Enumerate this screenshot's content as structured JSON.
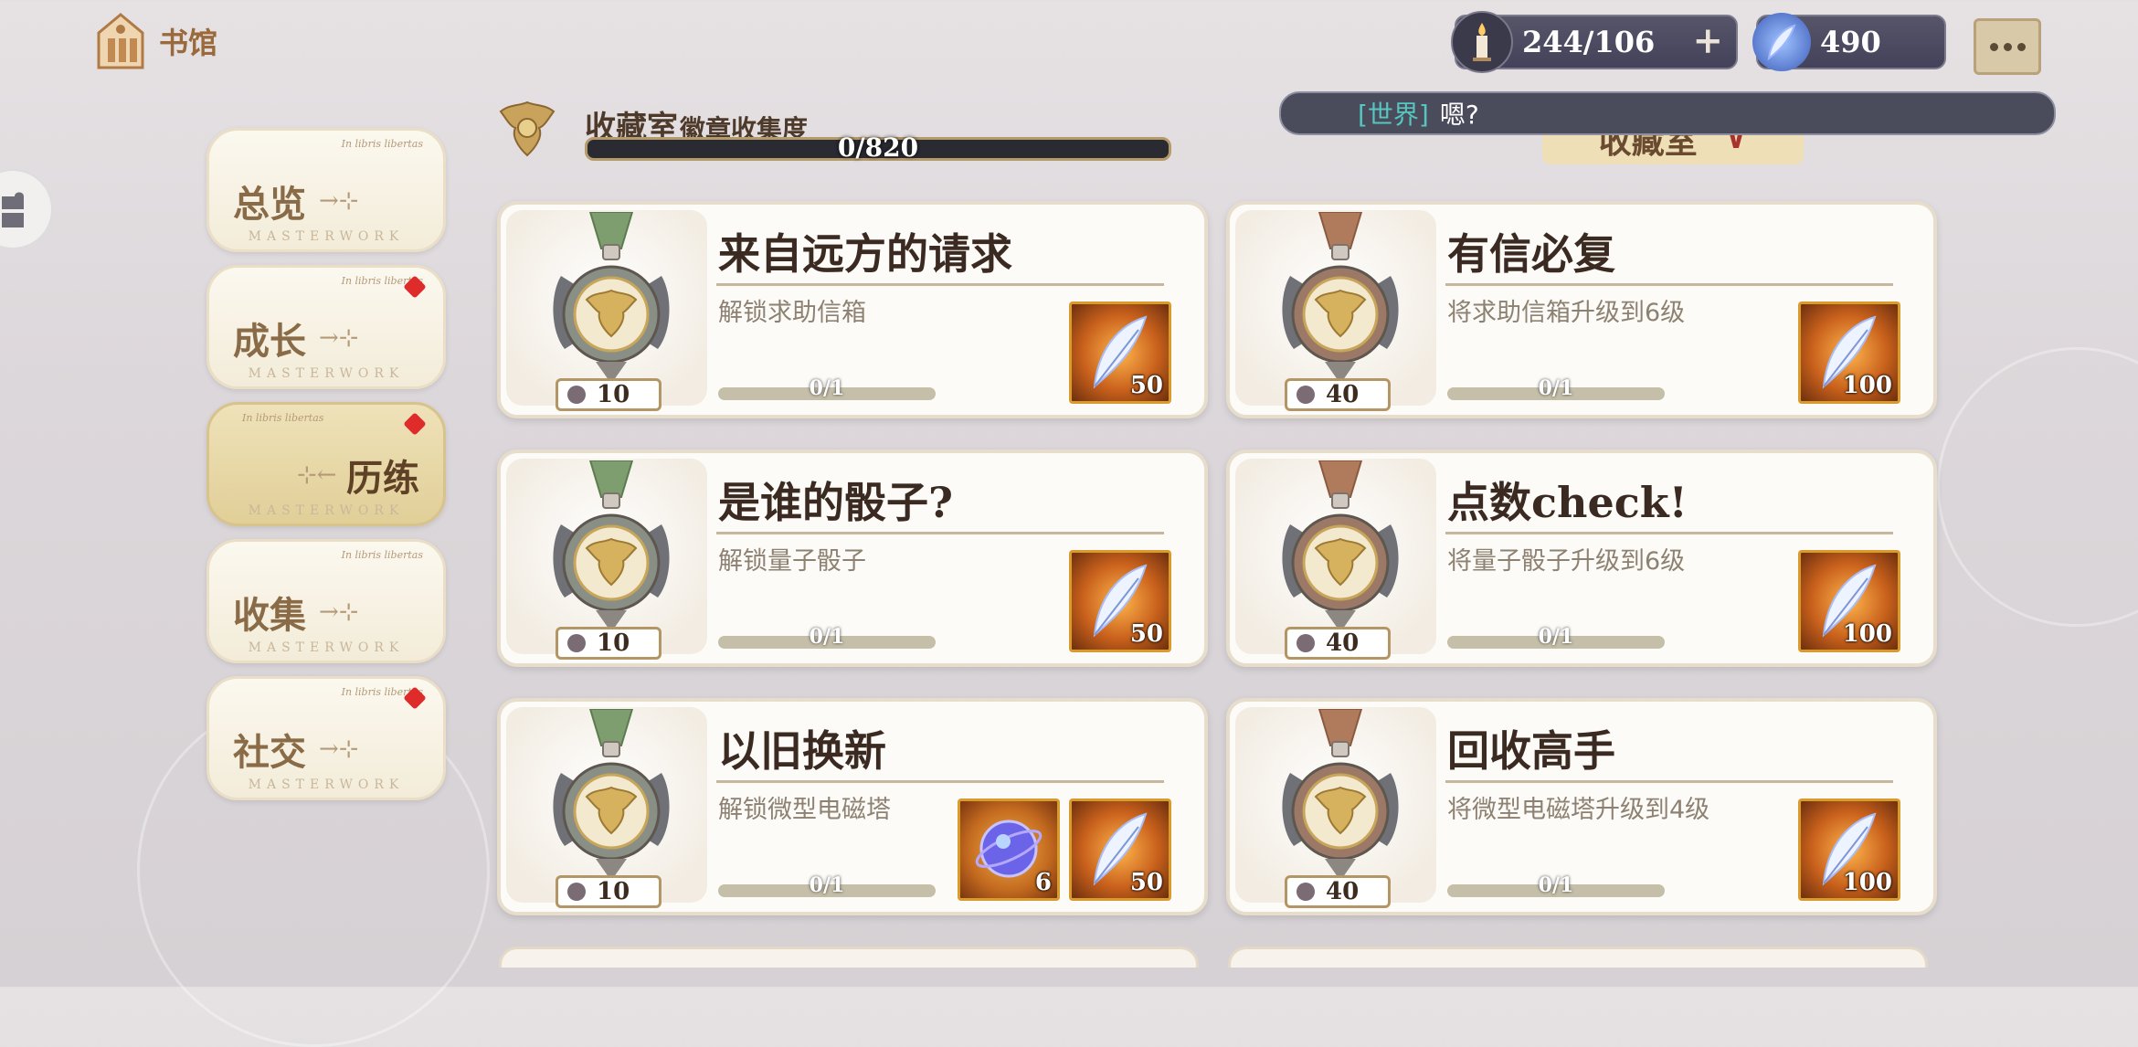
{
  "header": {
    "home_label": "书馆"
  },
  "resources": {
    "stamina": "244/106",
    "gems": "490"
  },
  "chat": {
    "channel": "[世界]",
    "message": "嗯?"
  },
  "dropdown": {
    "label": "收藏室",
    "chevron": "∨"
  },
  "nav": {
    "motto": "In libris libertas",
    "masterwork": "MASTERWORK",
    "items": [
      {
        "label": "总览",
        "active": false,
        "dot": false
      },
      {
        "label": "成长",
        "active": false,
        "dot": true
      },
      {
        "label": "历练",
        "active": true,
        "dot": true
      },
      {
        "label": "收集",
        "active": false,
        "dot": false
      },
      {
        "label": "社交",
        "active": false,
        "dot": true
      }
    ]
  },
  "collection": {
    "title": "收藏室",
    "subtitle": "徽章收集度",
    "progress": "0/820",
    "progress_fraction": 0
  },
  "cards": [
    {
      "title": "来自远方的请求",
      "desc": "解锁求助信箱",
      "medal": "green",
      "count": "10",
      "progress": "0/1",
      "rewards": [
        {
          "type": "feather",
          "qty": "50"
        }
      ]
    },
    {
      "title": "有信必复",
      "desc": "将求助信箱升级到6级",
      "medal": "bronze",
      "count": "40",
      "progress": "0/1",
      "rewards": [
        {
          "type": "feather",
          "qty": "100"
        }
      ]
    },
    {
      "title": "是谁的骰子?",
      "desc": "解锁量子骰子",
      "medal": "green",
      "count": "10",
      "progress": "0/1",
      "rewards": [
        {
          "type": "feather",
          "qty": "50"
        }
      ]
    },
    {
      "title": "点数check!",
      "desc": "将量子骰子升级到6级",
      "medal": "bronze",
      "count": "40",
      "progress": "0/1",
      "rewards": [
        {
          "type": "feather",
          "qty": "100"
        }
      ]
    },
    {
      "title": "以旧换新",
      "desc": "解锁微型电磁塔",
      "medal": "green",
      "count": "10",
      "progress": "0/1",
      "rewards": [
        {
          "type": "orb",
          "qty": "6"
        },
        {
          "type": "feather",
          "qty": "50"
        }
      ]
    },
    {
      "title": "回收高手",
      "desc": "将微型电磁塔升级到4级",
      "medal": "bronze",
      "count": "40",
      "progress": "0/1",
      "rewards": [
        {
          "type": "feather",
          "qty": "100"
        }
      ]
    }
  ]
}
